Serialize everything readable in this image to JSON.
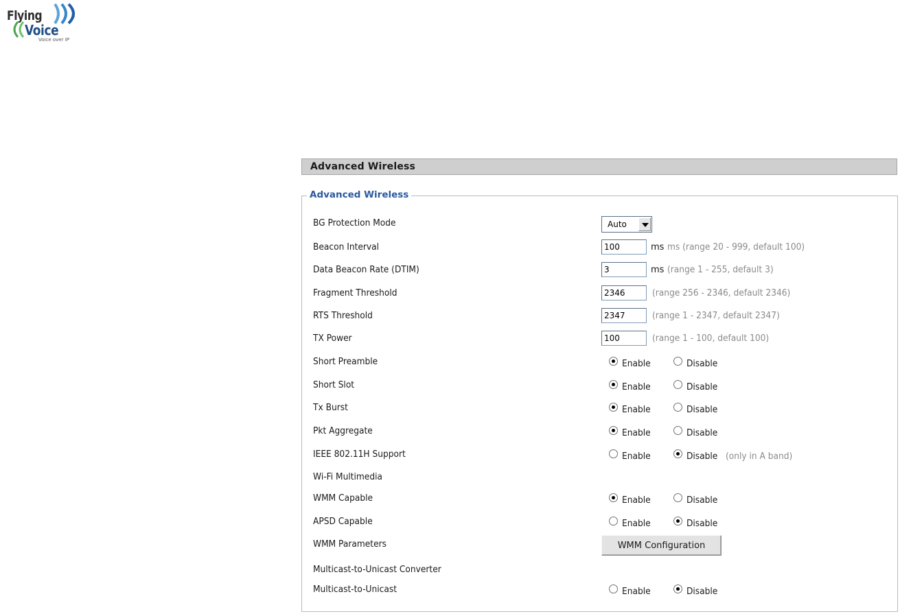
{
  "logo": {
    "line1": "Flying",
    "line2": "Voice",
    "tagline": "Voice over IP",
    "color_dark": "#2d2d2d",
    "color_brand": "#1f4f86"
  },
  "section": {
    "title": "Advanced Wireless"
  },
  "group": {
    "legend": "Advanced Wireless"
  },
  "fields": {
    "bg_protection": {
      "label": "BG Protection Mode",
      "value": "Auto"
    },
    "beacon_interval": {
      "label": "Beacon Interval",
      "value": "100",
      "unit": "ms",
      "hint": "ms (range 20 - 999, default 100)"
    },
    "dtim": {
      "label": "Data Beacon Rate (DTIM)",
      "value": "3",
      "unit": "ms",
      "hint": "(range 1 - 255, default 3)"
    },
    "fragment": {
      "label": "Fragment Threshold",
      "value": "2346",
      "hint": "(range 256 - 2346, default 2346)"
    },
    "rts": {
      "label": "RTS Threshold",
      "value": "2347",
      "hint": "(range 1 - 2347, default 2347)"
    },
    "tx_power": {
      "label": "TX Power",
      "value": "100",
      "hint": "(range 1 - 100, default 100)"
    },
    "short_preamble": {
      "label": "Short Preamble",
      "selected": "enable"
    },
    "short_slot": {
      "label": "Short Slot",
      "selected": "enable"
    },
    "tx_burst": {
      "label": "Tx Burst",
      "selected": "enable"
    },
    "pkt_aggregate": {
      "label": "Pkt Aggregate",
      "selected": "enable"
    },
    "ieee80211h": {
      "label": "IEEE 802.11H Support",
      "selected": "disable",
      "hint": "(only in A band)"
    },
    "wifi_multimedia": {
      "label": "Wi-Fi Multimedia"
    },
    "wmm_capable": {
      "label": "WMM Capable",
      "selected": "enable"
    },
    "apsd_capable": {
      "label": "APSD Capable",
      "selected": "disable"
    },
    "wmm_params": {
      "label": "WMM Parameters",
      "button": "WMM Configuration"
    },
    "m2u_heading": {
      "label": "Multicast-to-Unicast Converter"
    },
    "m2u": {
      "label": "Multicast-to-Unicast",
      "selected": "disable"
    }
  },
  "radio_labels": {
    "enable": "Enable",
    "disable": "Disable"
  },
  "colors": {
    "legend": "#2c5a9e",
    "hint": "#8a8a8a",
    "bar": "#cfcfcf"
  }
}
